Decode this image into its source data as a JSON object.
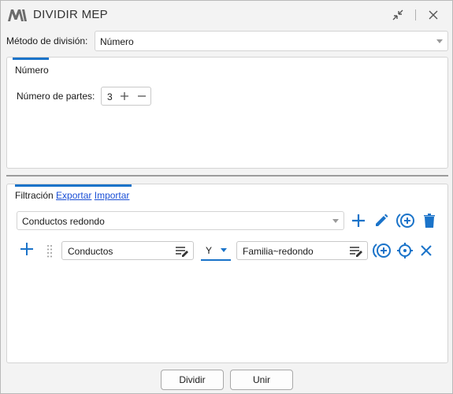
{
  "window": {
    "title": "DIVIDIR MEP"
  },
  "method": {
    "label": "Método de división:",
    "value": "Número"
  },
  "number_panel": {
    "tab_label": "Número",
    "parts_label": "Número de partes:",
    "parts_value": "3"
  },
  "filter_panel": {
    "tab_label": "Filtración",
    "export_label": "Exportar",
    "import_label": "Importar",
    "selected_filter": "Conductos redondo",
    "rule": {
      "category": "Conductos",
      "operator": "Y",
      "parameter": "Familia~redondo"
    }
  },
  "footer": {
    "divide_label": "Dividir",
    "join_label": "Unir"
  },
  "colors": {
    "accent": "#1a73c9",
    "link": "#1a4fd6"
  }
}
